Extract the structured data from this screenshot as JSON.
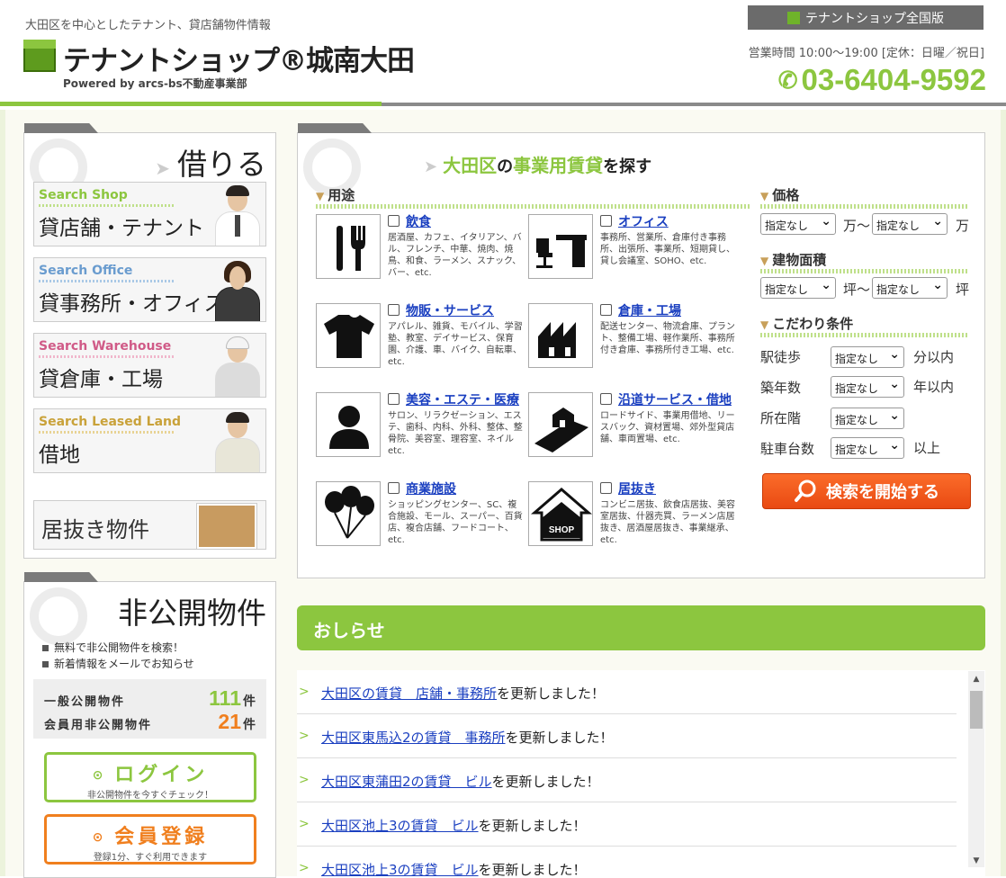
{
  "header": {
    "tagline": "大田区を中心としたテナント、貸店舗物件情報",
    "logo_name": "テナントショップ®城南大田",
    "logo_sub": "Powered by arcs-bs不動産事業部",
    "national_link": "テナントショップ全国版",
    "hours": "営業時間 10:00～19:00 [定休：日曜／祝日]",
    "phone": "03-6404-9592"
  },
  "rent": {
    "title": "借りる",
    "categories": [
      {
        "en": "Search Shop",
        "jp": "貸店舗・テナント"
      },
      {
        "en": "Search Office",
        "jp": "貸事務所・オフィス"
      },
      {
        "en": "Search Warehouse",
        "jp": "貸倉庫・工場"
      },
      {
        "en": "Search Leased Land",
        "jp": "借地"
      }
    ],
    "inuki": "居抜き物件"
  },
  "private": {
    "title": "非公開物件",
    "bullets": [
      "無料で非公開物件を検索！",
      "新着情報をメールでお知らせ"
    ],
    "general_label": "一般公開物件",
    "general_count": "111",
    "member_label": "会員用非公開物件",
    "member_count": "21",
    "unit": "件",
    "login_label": "ログイン",
    "login_sub": "非公開物件を今すぐチェック！",
    "register_label": "会員登録",
    "register_sub": "登録1分、すぐ利用できます"
  },
  "search": {
    "heading_ward": "大田区",
    "heading_no": "の",
    "heading_type": "事業用賃貸",
    "heading_tail": "を探す",
    "use_title": "用途",
    "uses": [
      {
        "name": "飲食",
        "desc": "居酒屋、カフェ、イタリアン、バル、フレンチ、中華、焼肉、焼鳥、和食、ラーメン、スナック、バー、etc."
      },
      {
        "name": "オフィス",
        "desc": "事務所、営業所、倉庫付き事務所、出張所、事業所、短期貸し、貸し会議室、SOHO、etc."
      },
      {
        "name": "物販・サービス",
        "desc": "アパレル、雑貨、モバイル、学習塾、教室、デイサービス、保育園、介護、車、バイク、自転車、etc."
      },
      {
        "name": "倉庫・工場",
        "desc": "配送センター、物流倉庫、プラント、整備工場、軽作業所、事務所付き倉庫、事務所付き工場、etc."
      },
      {
        "name": "美容・エステ・医療",
        "desc": "サロン、リラクゼーション、エステ、歯科、内科、外科、整体、整骨院、美容室、理容室、ネイル etc."
      },
      {
        "name": "沿道サービス・借地",
        "desc": "ロードサイド、事業用借地、リースバック、資材置場、郊外型貸店舗、車両置場、etc."
      },
      {
        "name": "商業施設",
        "desc": "ショッピングセンター、SC、複合施設、モール、スーパー、百貨店、複合店舗、フードコート、etc."
      },
      {
        "name": "居抜き",
        "desc": "コンビニ居抜、飲食店居抜、美容室居抜、什器売買、ラーメン店居抜き、居酒屋居抜き、事業継承、etc."
      }
    ],
    "price_title": "価格",
    "price_unit": "万",
    "price_sep": "万～",
    "area_title": "建物面積",
    "area_sep": "坪～",
    "area_unit": "坪",
    "cond_title": "こだわり条件",
    "unspecified": "指定なし",
    "conditions": [
      {
        "label": "駅徒歩",
        "suffix": "分以内"
      },
      {
        "label": "築年数",
        "suffix": "年以内"
      },
      {
        "label": "所在階",
        "suffix": ""
      },
      {
        "label": "駐車台数",
        "suffix": "以上"
      }
    ],
    "start_label": "検索を開始する"
  },
  "news": {
    "title": "おしらせ",
    "items": [
      {
        "link": "大田区の賃貸　店舗・事務所",
        "tail": "を更新しました！"
      },
      {
        "link": "大田区東馬込2の賃貸　事務所",
        "tail": "を更新しました！"
      },
      {
        "link": "大田区東蒲田2の賃貸　ビル",
        "tail": "を更新しました！"
      },
      {
        "link": "大田区池上3の賃貸　ビル",
        "tail": "を更新しました！"
      },
      {
        "link": "大田区池上3の賃貸　ビル",
        "tail": "を更新しました！"
      }
    ]
  },
  "colors": {
    "accent": "#8cc63f",
    "orange": "#f07f1e",
    "link": "#1a3fc0"
  }
}
